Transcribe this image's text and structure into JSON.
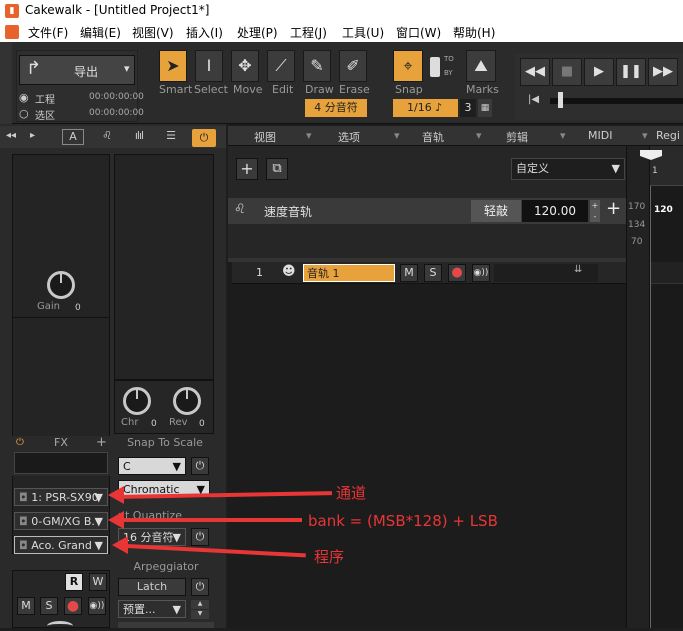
{
  "app": {
    "title": "Cakewalk - [Untitled Project1*]",
    "icon": "cakewalk-logo-icon"
  },
  "menu": [
    "文件(F)",
    "编辑(E)",
    "视图(V)",
    "插入(I)",
    "处理(P)",
    "工程(J)",
    "工具(U)",
    "窗口(W)",
    "帮助(H)"
  ],
  "toolbar": {
    "export_label": "导出",
    "radio_project": "工程",
    "radio_selection": "选区",
    "time1": "00:00:00:00",
    "time2": "00:00:00:00",
    "tools": [
      {
        "label": "Smart",
        "icon": "smart-tool-icon",
        "glyph": "➤"
      },
      {
        "label": "Select",
        "icon": "select-tool-icon",
        "glyph": "I"
      },
      {
        "label": "Move",
        "icon": "move-tool-icon",
        "glyph": "✥"
      },
      {
        "label": "Edit",
        "icon": "edit-tool-icon",
        "glyph": "⟋"
      },
      {
        "label": "Draw",
        "icon": "draw-tool-icon",
        "glyph": "✎"
      },
      {
        "label": "Erase",
        "icon": "erase-tool-icon",
        "glyph": "✐"
      }
    ],
    "quantize": "4 分音符",
    "snap_label": "Snap",
    "marks_label": "Marks",
    "to": "TO",
    "by": "BY",
    "snap_value": "1/16",
    "snap_num": "3"
  },
  "inspector": {
    "gain_label": "Gain",
    "gain_value": "0",
    "chr_label": "Chr",
    "chr_value": "0",
    "rev_label": "Rev",
    "rev_value": "0",
    "fx_label": "FX",
    "snap_to_scale": "Snap To Scale",
    "scale_root": "C",
    "scale_type": "Chromatic",
    "input_quantize": "ut Quantize",
    "iq_value": "16 分音符",
    "arpeggiator": "Arpeggiator",
    "latch": "Latch",
    "preset": "预置...",
    "channel": "1: PSR-SX90",
    "bank": "0-GM/XG B.",
    "program": "Aco. Grand",
    "r": "R",
    "w": "W",
    "m": "M",
    "s": "S"
  },
  "track_area": {
    "menus": [
      "视图",
      "选项",
      "音轨",
      "剪辑",
      "MIDI",
      "Regi"
    ],
    "custom": "自定义",
    "tempo_track": "速度音轨",
    "tap": "轻敲",
    "tempo_value": "120.00",
    "ruler": {
      "r1": "1",
      "r170": "170",
      "r120": "120",
      "r134": "134",
      "r70": "70"
    },
    "track_num": "1",
    "track_name": "音轨 1",
    "m": "M",
    "s": "S"
  },
  "annotations": {
    "channel": "通道",
    "bank": "bank = (MSB*128) + LSB",
    "program": "程序"
  }
}
